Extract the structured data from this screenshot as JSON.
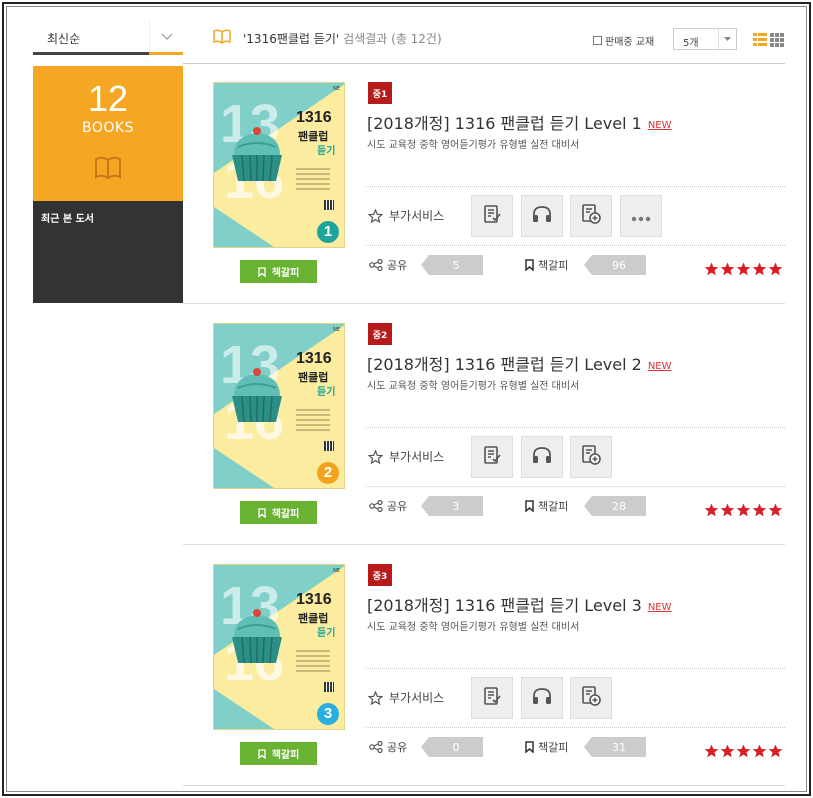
{
  "sort": {
    "label": "최신순"
  },
  "search": {
    "query": "'1316팬클럽 듣기'",
    "result_text": "검색결과 (총 12건)"
  },
  "filters": {
    "onsale_label": "판매중 교재",
    "count_value": "5개"
  },
  "left_panel": {
    "count": "12",
    "books_label": "BOOKS",
    "recent_label": "최근 본 도서"
  },
  "labels": {
    "service": "부가서비스",
    "share": "공유",
    "bookmark": "책갈피",
    "bookmark_button": "책갈피"
  },
  "colors": {
    "accent": "#f5a623",
    "green": "#6ab232",
    "grade_red": "#b71a1a",
    "star_red": "#d61f26"
  },
  "books": [
    {
      "grade": "중1",
      "title": "[2018개정] 1316 팬클럽 듣기 Level 1",
      "new_badge": "NEW",
      "subtitle": "시도 교육청 중학 영어듣기평가 유형별 실전 대비서",
      "cover": {
        "title": "1316",
        "line1": "팬클럽",
        "line2": "듣기",
        "level": "1",
        "level_color": "#1ea59a"
      },
      "share_count": "5",
      "bookmark_count": "96",
      "rating": 5,
      "services": [
        "worksheet-icon",
        "headphones-icon",
        "add-document-icon",
        "more-icon"
      ]
    },
    {
      "grade": "중2",
      "title": "[2018개정] 1316 팬클럽 듣기 Level 2",
      "new_badge": "NEW",
      "subtitle": "시도 교육청 중학 영어듣기평가 유형별 실전 대비서",
      "cover": {
        "title": "1316",
        "line1": "팬클럽",
        "line2": "듣기",
        "level": "2",
        "level_color": "#f2a21b"
      },
      "share_count": "3",
      "bookmark_count": "28",
      "rating": 5,
      "services": [
        "worksheet-icon",
        "headphones-icon",
        "add-document-icon"
      ]
    },
    {
      "grade": "중3",
      "title": "[2018개정] 1316 팬클럽 듣기 Level 3",
      "new_badge": "NEW",
      "subtitle": "시도 교육청 중학 영어듣기평가 유형별 실전 대비서",
      "cover": {
        "title": "1316",
        "line1": "팬클럽",
        "line2": "듣기",
        "level": "3",
        "level_color": "#2aaee0"
      },
      "share_count": "0",
      "bookmark_count": "31",
      "rating": 5,
      "services": [
        "worksheet-icon",
        "headphones-icon",
        "add-document-icon"
      ]
    }
  ]
}
